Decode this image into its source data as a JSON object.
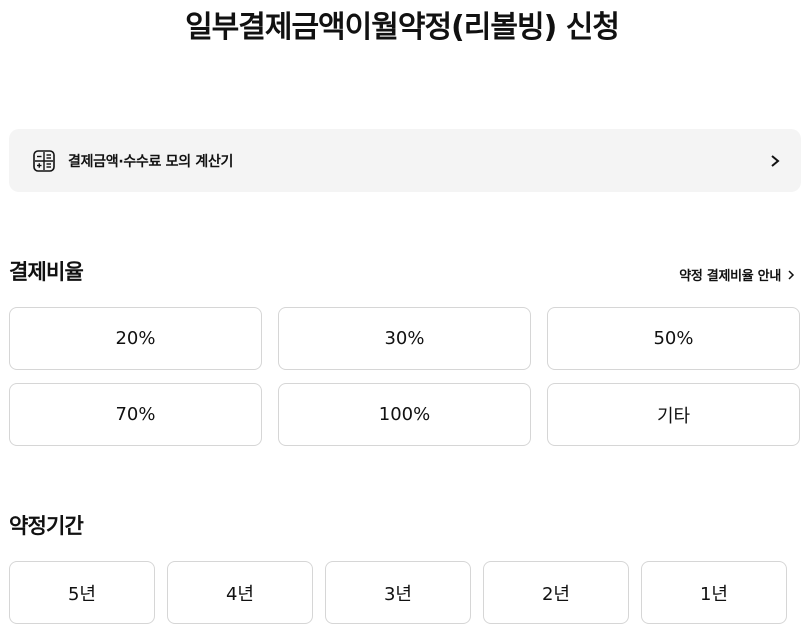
{
  "page": {
    "title": "일부결제금액이월약정(리볼빙) 신청"
  },
  "calculator": {
    "label": "결제금액·수수료 모의 계산기",
    "icon": "calculator-icon"
  },
  "payment_ratio": {
    "title": "결제비율",
    "guide_link": "약정 결제비율 안내",
    "options": [
      "20%",
      "30%",
      "50%",
      "70%",
      "100%",
      "기타"
    ]
  },
  "contract_period": {
    "title": "약정기간",
    "options": [
      "5년",
      "4년",
      "3년",
      "2년",
      "1년"
    ]
  },
  "colors": {
    "banner_bg": "#f4f4f4",
    "border": "#d6d6d6",
    "text": "#111111"
  }
}
